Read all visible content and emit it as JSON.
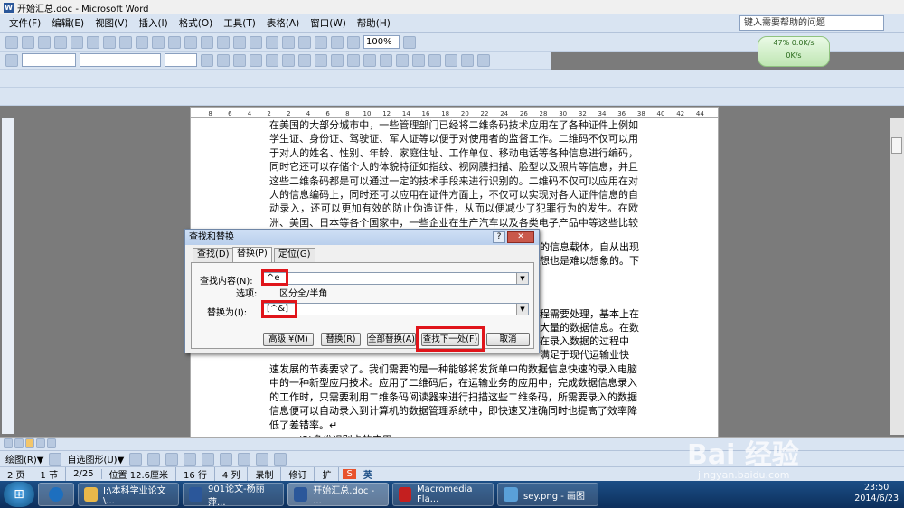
{
  "window": {
    "title": "开始汇总.doc - Microsoft Word"
  },
  "menu": [
    "文件(F)",
    "编辑(E)",
    "视图(V)",
    "插入(I)",
    "格式(O)",
    "工具(T)",
    "表格(A)",
    "窗口(W)",
    "帮助(H)"
  ],
  "help_placeholder": "键入需要帮助的问题",
  "toolbar": {
    "zoom": "100%"
  },
  "network_widget": {
    "percent": "47%",
    "speed1": "0.0K/s",
    "speed2": "0K/s"
  },
  "ruler_ticks": [
    "8",
    "6",
    "4",
    "2",
    "2",
    "4",
    "6",
    "8",
    "10",
    "12",
    "14",
    "16",
    "18",
    "20",
    "22",
    "24",
    "26",
    "28",
    "30",
    "32",
    "34",
    "36",
    "38",
    "40",
    "42",
    "44"
  ],
  "document": {
    "paragraph1": "在美国的大部分城市中，一些管理部门已经将二维条码技术应用在了各种证件上例如学生证、身份证、驾驶证、军人证等以便于对使用者的监督工作。二维码不仅可以用于对人的姓名、性别、年龄、家庭住址、工作单位、移动电话等各种信息进行编码，同时它还可以存储个人的体貌特征如指纹、视网膜扫描、脸型以及照片等信息，并且这些二维条码都是可以通过一定的技术手段来进行识别的。二维码不仅可以应用在对人的信息编码上，同时还可以应用在证件方面上，不仅可以实现对各人证件信息的自动录入，还可以更加有效的防止伪造证件，从而以便减少了犯罪行为的发生。在欧洲、美国、日本等各个国家中，一些企业在生产汽车以及各类电子产品中等这些比较昂贵的商品生产制造的过程中也开始应用二维码技术。↵",
    "fragment_right1": "的信息载体，自从出现",
    "fragment_right2": "想也是难以想象的。下",
    "fragment_right3": "程需要处理，基本上在",
    "fragment_right4": "大量的数据信息。在数",
    "fragment_right5": "在录入数据的过程中",
    "fragment_right6": "满足于现代运输业快",
    "paragraph2_lines": [
      "速发展的节奏要求了。我们需要的是一种能够将发货单中的数据信息快速的录入电脑",
      "中的一种新型应用技术。应用了二维码后，在运输业务的应用中，完成数据信息录入",
      "的工作时，只需要利用二维条码阅读器来进行扫描这些二维条码，所需要录入的数据",
      "信息便可以自动录入到计算机的数据管理系统中，即快速又准确同时也提高了效率降",
      "低了差错率。↵"
    ],
    "section_heading": "(3)身份识别卡的应用："
  },
  "dialog": {
    "title": "查找和替换",
    "tabs": [
      "查找(D)",
      "替换(P)",
      "定位(G)"
    ],
    "find_label": "查找内容(N):",
    "find_value": "^e",
    "options_label": "选项:",
    "options_value": "区分全/半角",
    "replace_label": "替换为(I):",
    "replace_value": "[^&]",
    "buttons": {
      "more": "高级 ¥(M)",
      "replace": "替换(R)",
      "replace_all": "全部替换(A)",
      "find_next": "查找下一处(F)",
      "cancel": "取消"
    }
  },
  "drawbar": {
    "draw": "绘图(R)▼",
    "autoshapes": "自选图形(U)▼"
  },
  "status": {
    "page": "2 页",
    "section": "1 节",
    "pages": "2/25",
    "pos": "位置 12.6厘米",
    "line": "16 行",
    "col": "4 列",
    "rec": "录制",
    "trk": "修订",
    "ext": "扩"
  },
  "ime": "英",
  "taskbar": {
    "items": [
      "I:\\本科学业论文\\...",
      "901论文-杨丽萍...",
      "开始汇总.doc - ...",
      "Macromedia Fla...",
      "sey.png - 画图"
    ],
    "time": "23:50",
    "date": "2014/6/23"
  },
  "watermark": {
    "brand": "Bai 经验",
    "url": "jingyan.baidu.com"
  },
  "colors": {
    "red_highlight": "#e0151b",
    "titlebar": "#d9e4f2",
    "taskbar": "#1b4e86"
  }
}
